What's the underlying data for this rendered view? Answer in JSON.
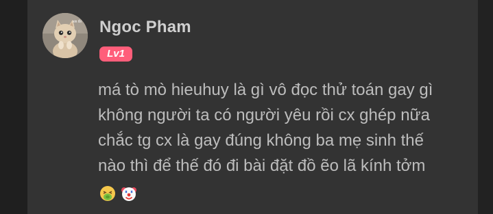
{
  "comment": {
    "user": {
      "name": "Ngoc Pham",
      "level": "Lv1",
      "avatar_caption": "xin lỗi"
    },
    "message": {
      "text": "má tò mò hieuhuy là gì vô đọc thử toán gay gì không người ta có người yêu rồi cx ghép nữa chắc tg cx là gay đúng không ba mẹ sinh thế nào thì để thế đó đi bài đặt đồ ẽo lã kính tởm",
      "emojis": [
        "nauseated-face-icon",
        "clown-face-icon"
      ]
    },
    "colors": {
      "background": "#333333",
      "username": "#cfcfcf",
      "message": "#bdbdbd",
      "level_badge": "#ff5e7a"
    }
  }
}
